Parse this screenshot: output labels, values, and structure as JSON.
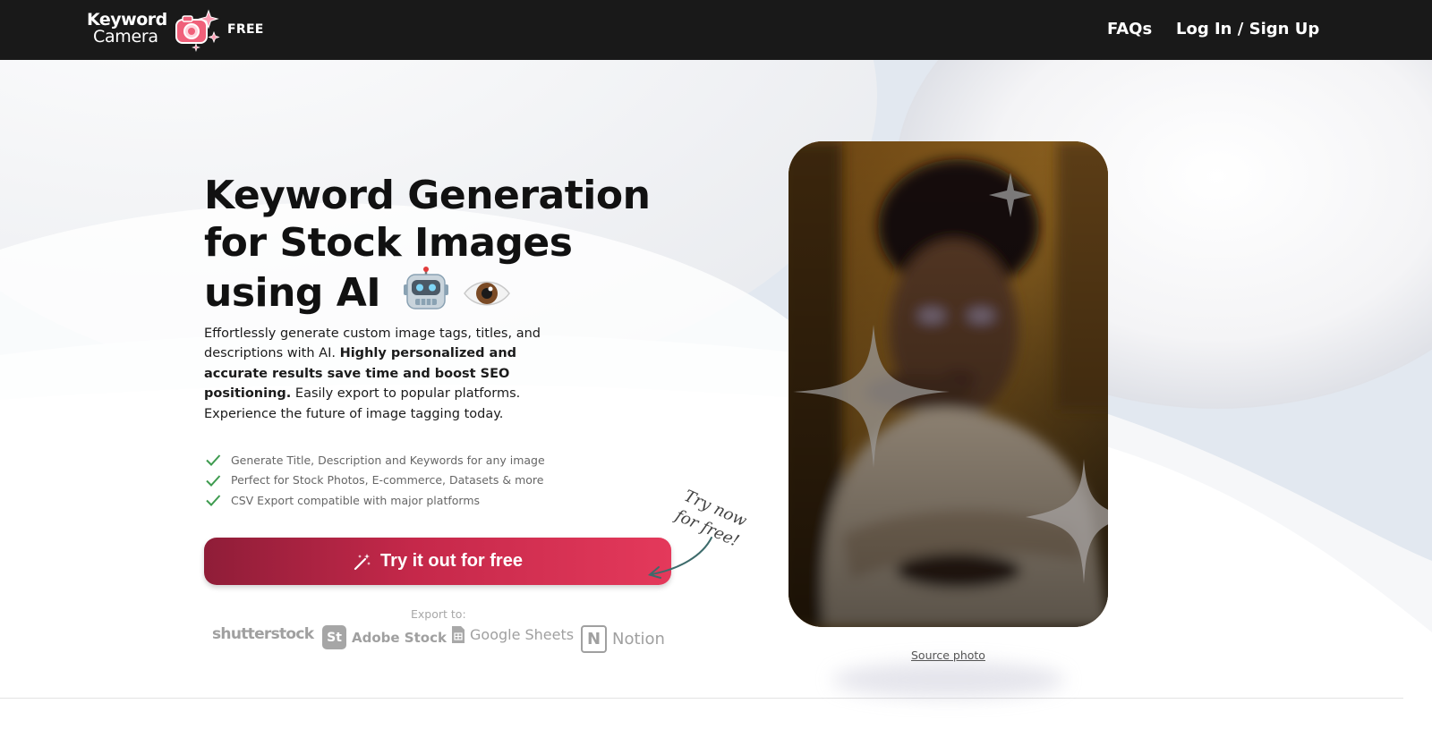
{
  "nav": {
    "logo_line1": "Keyword",
    "logo_line2": "Camera",
    "badge": "FREE",
    "links": [
      "FAQs",
      "Log In / Sign Up"
    ]
  },
  "hero": {
    "headline_lines": [
      "Keyword Generation",
      "for Stock Images",
      "using AI"
    ],
    "headline_emoji": [
      "robot-emoji",
      "eye-emoji"
    ],
    "description": {
      "part1": "Effortlessly generate custom image tags, titles, and descriptions with AI. ",
      "bold": "Highly personalized and accurate results save time and boost SEO positioning.",
      "part2": " Easily export to popular platforms. Experience the future of image tagging today."
    },
    "features": [
      "Generate Title, Description and Keywords for any image",
      "Perfect for Stock Photos, E-commerce, Datasets & more",
      "CSV Export compatible with major platforms"
    ],
    "cta_label": "Try it out for free",
    "cta_icon": "magic-wand-icon",
    "export_label": "Export to:",
    "export_brands": [
      "shutterstock",
      "Adobe Stock",
      "Google Sheets",
      "Notion"
    ],
    "adobe_mark": "St",
    "notion_mark": "N",
    "handwritten_note": [
      "Try now",
      "for free!"
    ],
    "source_link": "Source photo"
  },
  "colors": {
    "nav_bg": "#191919",
    "cta_start": "#8f1d38",
    "cta_end": "#e4395b",
    "check": "#3e9b4f",
    "logo_pink": "#f0607a"
  }
}
